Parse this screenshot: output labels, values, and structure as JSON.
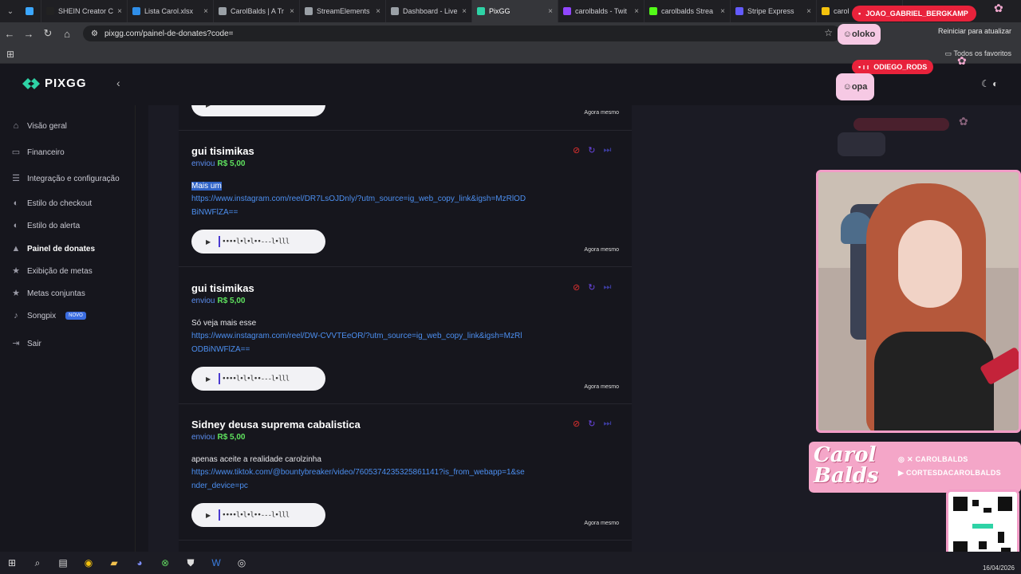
{
  "browser": {
    "tabs": [
      {
        "title": "",
        "active": false,
        "color": "#3ba7ff"
      },
      {
        "title": "SHEIN Creator C",
        "active": false,
        "color": "#222222"
      },
      {
        "title": "Lista Carol.xlsx",
        "active": false,
        "color": "#2f8ee8"
      },
      {
        "title": "CarolBalds | A Tr",
        "active": false,
        "color": "#9aa0a6"
      },
      {
        "title": "StreamElements",
        "active": false,
        "color": "#9aa0a6"
      },
      {
        "title": "Dashboard - Live",
        "active": false,
        "color": "#9aa0a6"
      },
      {
        "title": "PixGG",
        "active": true,
        "color": "#2ed3a6"
      },
      {
        "title": "carolbalds - Twit",
        "active": false,
        "color": "#9146ff"
      },
      {
        "title": "carolbalds Strea",
        "active": false,
        "color": "#53fc18"
      },
      {
        "title": "Stripe Express",
        "active": false,
        "color": "#635bff"
      },
      {
        "title": "carol",
        "active": false,
        "color": "#f4c20d"
      }
    ],
    "url": "pixgg.com/painel-de-donates?code=",
    "restart_label": "Reiniciar para atualizar",
    "favorites_label": "Todos os favoritos"
  },
  "app": {
    "logo": "PIXGG",
    "nav": [
      {
        "label": "Visão geral",
        "icon": "home-icon",
        "active": false
      },
      {
        "label": "Financeiro",
        "icon": "wallet-icon",
        "active": false
      },
      {
        "label": "Integração e configuração",
        "icon": "settings-icon",
        "active": false
      },
      {
        "label": "Estilo do checkout",
        "icon": "palette-icon",
        "active": false
      },
      {
        "label": "Estilo do alerta",
        "icon": "palette-icon",
        "active": false
      },
      {
        "label": "Painel de donates",
        "icon": "chart-icon",
        "active": true
      },
      {
        "label": "Exibição de metas",
        "icon": "star-icon",
        "active": false
      },
      {
        "label": "Metas conjuntas",
        "icon": "star-icon",
        "active": false
      },
      {
        "label": "Songpix",
        "icon": "music-icon",
        "active": false,
        "badge": "NOVO"
      },
      {
        "label": "Sair",
        "icon": "logout-icon",
        "active": false
      }
    ]
  },
  "donates": [
    {
      "name": "gui tisimikas",
      "verb": "enviou",
      "amount": "R$ 5,00",
      "message": "Mais um",
      "highlighted": true,
      "link": "https://www.instagram.com/reel/DR7LsOJDnly/?utm_source=ig_web_copy_link&igsh=MzRlODBiNWFlZA==",
      "time": "Agora mesmo"
    },
    {
      "name": "gui tisimikas",
      "verb": "enviou",
      "amount": "R$ 5,00",
      "message": "Só veja mais esse",
      "highlighted": false,
      "link": "https://www.instagram.com/reel/DW-CVVTEeOR/?utm_source=ig_web_copy_link&igsh=MzRlODBiNWFlZA==",
      "time": "Agora mesmo"
    },
    {
      "name": "Sidney deusa suprema cabalistica",
      "verb": "enviou",
      "amount": "R$ 5,00",
      "message": "apenas aceite a realidade carolzinha",
      "highlighted": false,
      "link": "https://www.tiktok.com/@bountybreaker/video/7605374235325861141?is_from_webapp=1&sender_device=pc",
      "time": "Agora mesmo"
    }
  ],
  "top_time": "Agora mesmo",
  "overlay": {
    "chat_name_1": "JOAO_GABRIEL_BERGKAMP",
    "chat_msg_1": "oloko",
    "chat_name_2": "ODIEGO_RODS",
    "chat_msg_2": "opa",
    "brand": "Carol Balds",
    "social_1": "CAROLBALDS",
    "social_2": "CORTESDACAROLBALDS"
  },
  "taskbar": {
    "date": "16/04/2026"
  }
}
